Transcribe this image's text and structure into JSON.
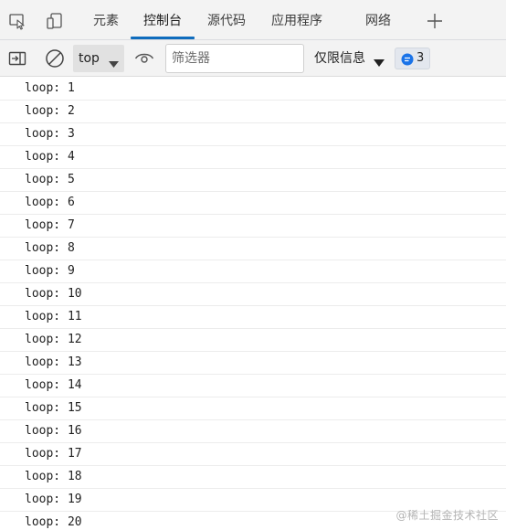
{
  "tabbar": {
    "icons": [
      "inspect-element-icon",
      "device-emulation-icon"
    ],
    "tabs": [
      {
        "label": "元素",
        "active": false
      },
      {
        "label": "控制台",
        "active": true
      },
      {
        "label": "源代码",
        "active": false
      },
      {
        "label": "应用程序",
        "active": false
      },
      {
        "label": "网络",
        "active": false
      }
    ],
    "add_tab_icon": "plus-icon"
  },
  "toolbar": {
    "sidebar_toggle_icon": "sidebar-toggle-icon",
    "clear_icon": "clear-console-icon",
    "context": "top",
    "live_expression_icon": "eye-icon",
    "filter_placeholder": "筛选器",
    "filter_value": "",
    "levels_label": "仅限信息",
    "issues_count": "3"
  },
  "console": {
    "logs": [
      "loop: 1",
      "loop: 2",
      "loop: 3",
      "loop: 4",
      "loop: 5",
      "loop: 6",
      "loop: 7",
      "loop: 8",
      "loop: 9",
      "loop: 10",
      "loop: 11",
      "loop: 12",
      "loop: 13",
      "loop: 14",
      "loop: 15",
      "loop: 16",
      "loop: 17",
      "loop: 18",
      "loop: 19",
      "loop: 20"
    ]
  },
  "watermark": "@稀土掘金技术社区",
  "colors": {
    "accent": "#0f6cbd",
    "issues_icon": "#1a73e8",
    "panel_bg": "#f3f3f3"
  }
}
